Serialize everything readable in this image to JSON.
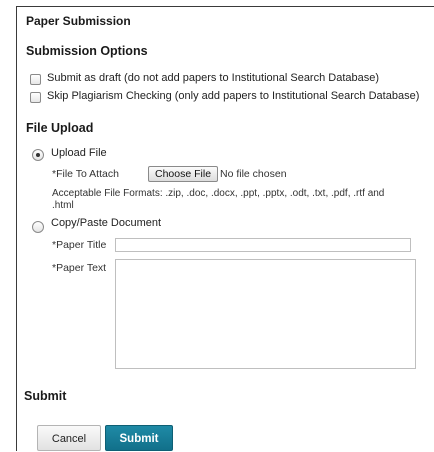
{
  "page_title": "Paper Submission",
  "submission_options": {
    "heading": "Submission Options",
    "draft_label": "Submit as draft (do not add papers to Institutional Search Database)",
    "skip_plagiarism_label": "Skip Plagiarism Checking (only add papers to Institutional Search Database)"
  },
  "file_upload": {
    "heading": "File Upload",
    "upload_file_label": "Upload File",
    "file_to_attach_label": "*File To Attach",
    "choose_file_button": "Choose File",
    "no_file_text": "No file chosen",
    "acceptable_formats_line1": "Acceptable File Formats: .zip, .doc, .docx, .ppt, .pptx, .odt, .txt, .pdf, .rtf and",
    "acceptable_formats_line2": ".html",
    "copy_paste_label": "Copy/Paste Document",
    "paper_title_label": "*Paper Title",
    "paper_title_value": "",
    "paper_text_label": "*Paper Text",
    "paper_text_value": ""
  },
  "submit_section": {
    "heading": "Submit",
    "cancel_button": "Cancel",
    "submit_button": "Submit"
  },
  "colors": {
    "submit_button": "#11708a",
    "border": "#3a3a3a"
  }
}
